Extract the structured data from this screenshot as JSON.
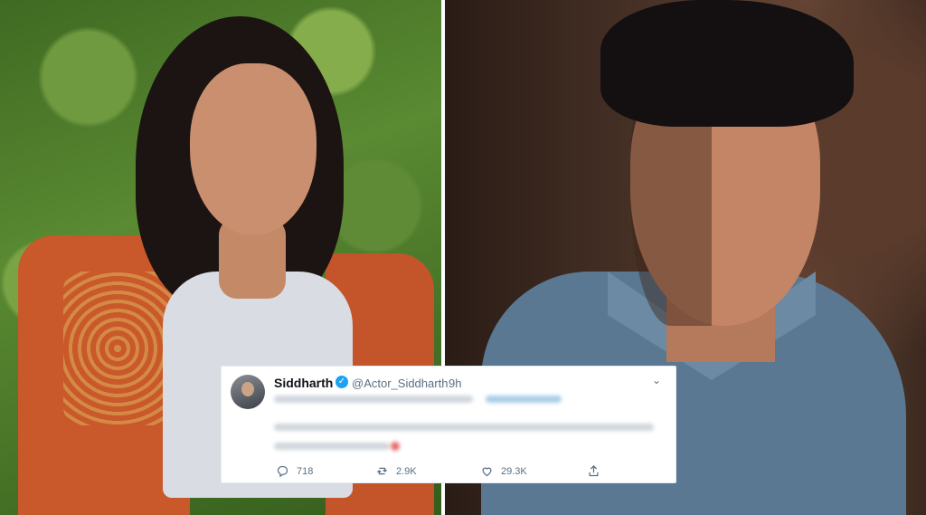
{
  "tweet": {
    "name": "Siddharth",
    "handle": "@Actor_Siddharth",
    "time": "9h",
    "actions": {
      "reply_count": "718",
      "retweet_count": "2.9K",
      "like_count": "29.3K"
    }
  },
  "icons": {
    "verified": "verified-badge-icon",
    "reply": "reply-icon",
    "retweet": "retweet-icon",
    "like": "heart-icon",
    "share": "share-icon"
  },
  "colors": {
    "twitter_blue": "#1da1f2",
    "muted_text": "#5b7083"
  }
}
